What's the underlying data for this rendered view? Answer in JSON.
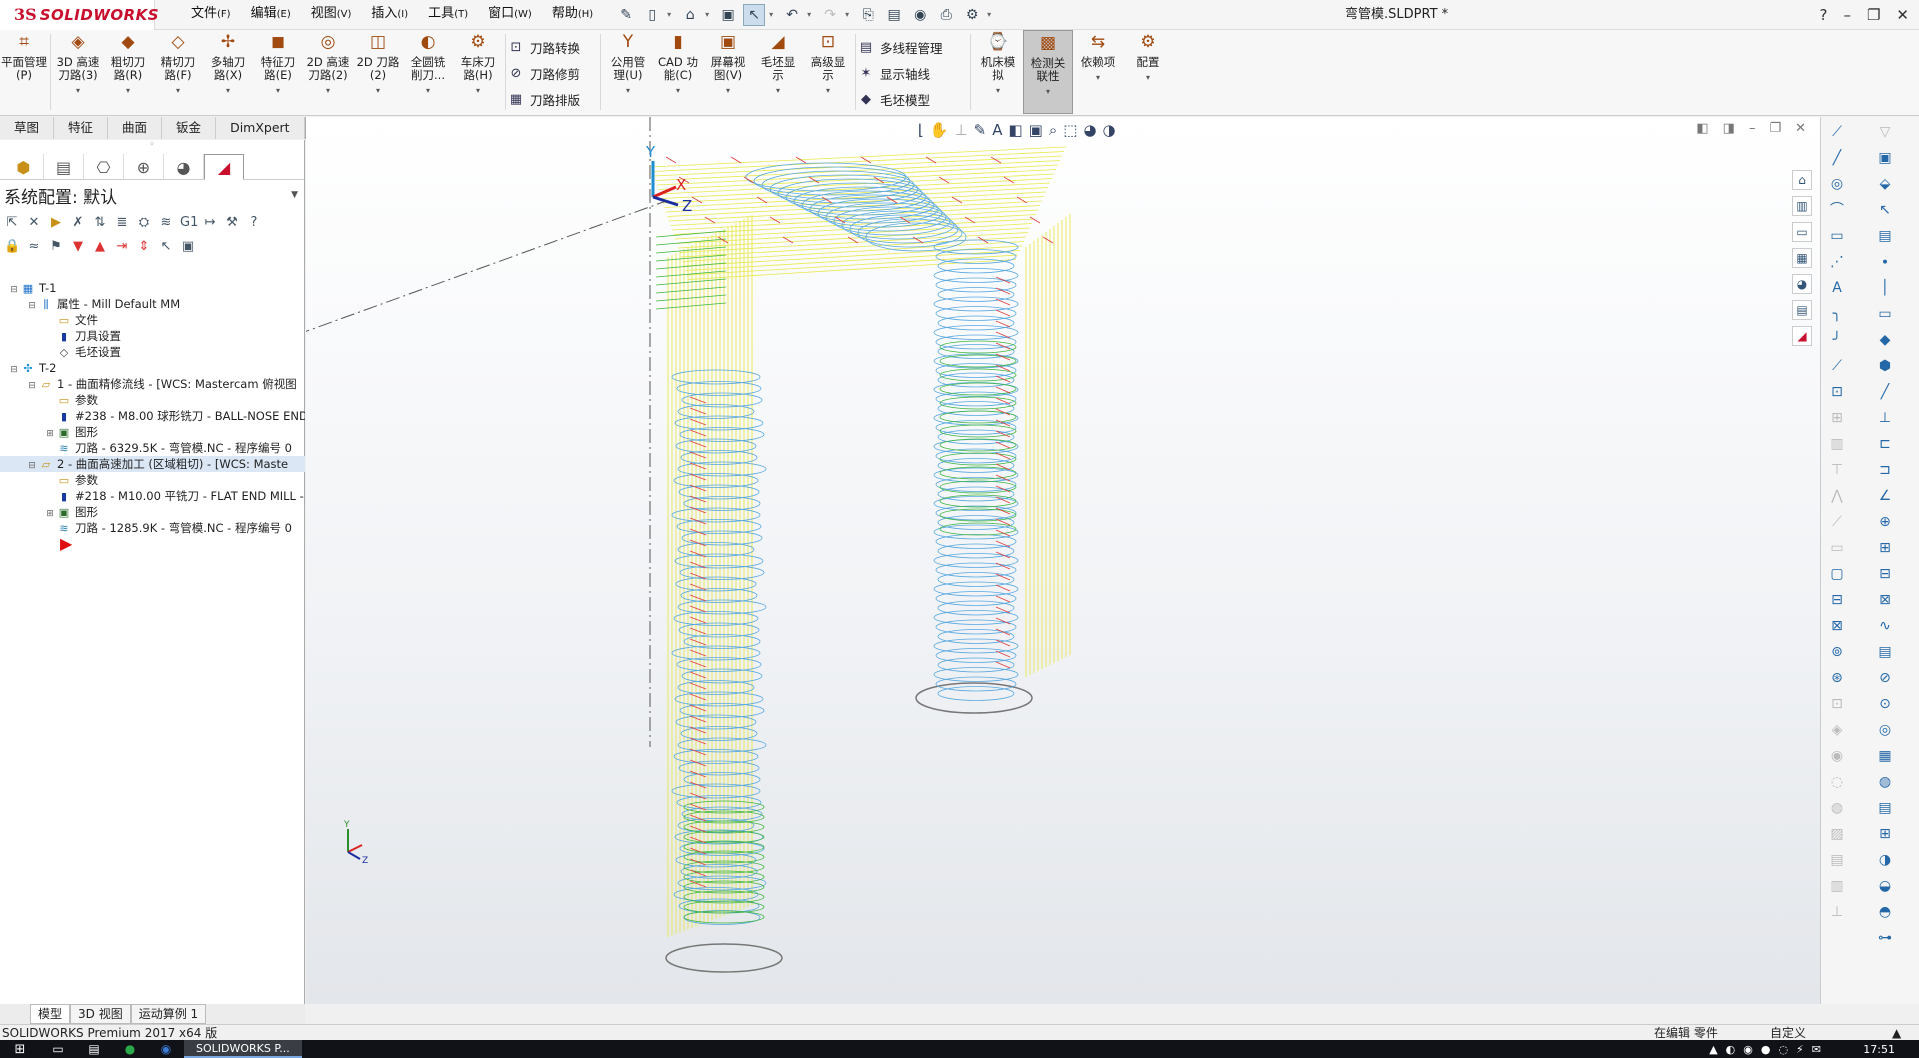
{
  "app": {
    "logo_prefix": "3S",
    "logo_text": "SOLIDWORKS",
    "document_title": "弯管模.SLDPRT *"
  },
  "menus": [
    {
      "label": "文件",
      "key": "(F)"
    },
    {
      "label": "编辑",
      "key": "(E)"
    },
    {
      "label": "视图",
      "key": "(V)"
    },
    {
      "label": "插入",
      "key": "(I)"
    },
    {
      "label": "工具",
      "key": "(T)"
    },
    {
      "label": "窗口",
      "key": "(W)"
    },
    {
      "label": "帮助",
      "key": "(H)"
    }
  ],
  "window_controls": {
    "help": "?",
    "minimize": "–",
    "restore": "❐",
    "close": "✕"
  },
  "command_manager": {
    "plane_manager": "平面管理(P)",
    "tools_a": [
      {
        "line1": "3D 高速",
        "line2": "刀路(3)"
      },
      {
        "line1": "粗切刀",
        "line2": "路(R)"
      },
      {
        "line1": "精切刀",
        "line2": "路(F)"
      },
      {
        "line1": "多轴刀",
        "line2": "路(X)"
      },
      {
        "line1": "特征刀",
        "line2": "路(E)"
      },
      {
        "line1": "2D 高速",
        "line2": "刀路(2)"
      },
      {
        "line1": "2D 刀路",
        "line2": "(2)"
      },
      {
        "line1": "全圆铣",
        "line2": "削刀..."
      },
      {
        "line1": "车床刀",
        "line2": "路(H)"
      }
    ],
    "stack_a": [
      "刀路转换",
      "刀路修剪",
      "刀路排版"
    ],
    "tools_b": [
      {
        "line1": "公用管",
        "line2": "理(U)"
      },
      {
        "line1": "CAD 功",
        "line2": "能(C)"
      },
      {
        "line1": "屏幕视",
        "line2": "图(V)"
      },
      {
        "line1": "毛坯显",
        "line2": "示"
      },
      {
        "line1": "高级显",
        "line2": "示"
      }
    ],
    "stack_b": [
      "多线程管理",
      "显示轴线",
      "毛坯模型"
    ],
    "tools_c": [
      {
        "line1": "机床模",
        "line2": "拟"
      },
      {
        "line1": "检测关",
        "line2": "联性"
      },
      {
        "line1": "依赖项",
        "line2": ""
      },
      {
        "line1": "配置",
        "line2": ""
      }
    ]
  },
  "tabs": [
    "草图",
    "特征",
    "曲面",
    "钣金",
    "DimXpert",
    "Mastercam2020"
  ],
  "left_panel": {
    "config_label": "系统配置:  默认",
    "tree": [
      {
        "indent": 0,
        "expander": "⊟",
        "icon": "▦",
        "label": "T-1"
      },
      {
        "indent": 1,
        "expander": "⊟",
        "icon": "⫼",
        "label": "属性 - Mill Default MM"
      },
      {
        "indent": 2,
        "expander": "",
        "icon": "▭",
        "label": "文件"
      },
      {
        "indent": 2,
        "expander": "",
        "icon": "▮",
        "label": "刀具设置"
      },
      {
        "indent": 2,
        "expander": "",
        "icon": "◇",
        "label": "毛坯设置"
      },
      {
        "indent": 0,
        "expander": "⊟",
        "icon": "✣",
        "label": "T-2"
      },
      {
        "indent": 1,
        "expander": "⊟",
        "icon": "▱",
        "label": "1 - 曲面精修流线 - [WCS: Mastercam 俯视图"
      },
      {
        "indent": 2,
        "expander": "",
        "icon": "▭",
        "label": "参数"
      },
      {
        "indent": 2,
        "expander": "",
        "icon": "▮",
        "label": "#238 - M8.00 球形铣刀 - BALL-NOSE END"
      },
      {
        "indent": 2,
        "expander": "⊞",
        "icon": "▣",
        "label": "图形"
      },
      {
        "indent": 2,
        "expander": "",
        "icon": "≋",
        "label": "刀路 - 6329.5K - 弯管模.NC - 程序编号 0"
      },
      {
        "indent": 1,
        "expander": "⊟",
        "icon": "▱",
        "label": "2 - 曲面高速加工 (区域粗切) - [WCS: Maste",
        "selected": true
      },
      {
        "indent": 2,
        "expander": "",
        "icon": "▭",
        "label": "参数"
      },
      {
        "indent": 2,
        "expander": "",
        "icon": "▮",
        "label": "#218 - M10.00 平铣刀 - FLAT END MILL -"
      },
      {
        "indent": 2,
        "expander": "⊞",
        "icon": "▣",
        "label": "图形"
      },
      {
        "indent": 2,
        "expander": "",
        "icon": "≋",
        "label": "刀路 - 1285.9K - 弯管模.NC - 程序编号 0"
      }
    ],
    "bottom_tabs": [
      "模型",
      "3D 视图",
      "运动算例 1"
    ]
  },
  "axis": {
    "x": "X",
    "y": "Y",
    "z": "Z"
  },
  "status": {
    "left": "SOLIDWORKS Premium 2017 x64 版",
    "mid": "在编辑 零件",
    "right": "自定义",
    "caret": "▲"
  },
  "taskbar": {
    "app": "SOLIDWORKS P...",
    "clock": "17:51"
  },
  "colors": {
    "brand": "#c8102e",
    "toolpath_yellow": "#e8e84a",
    "toolpath_blue": "#58a8e0",
    "toolpath_green": "#3bb53b",
    "toolpath_red": "#e04040"
  }
}
